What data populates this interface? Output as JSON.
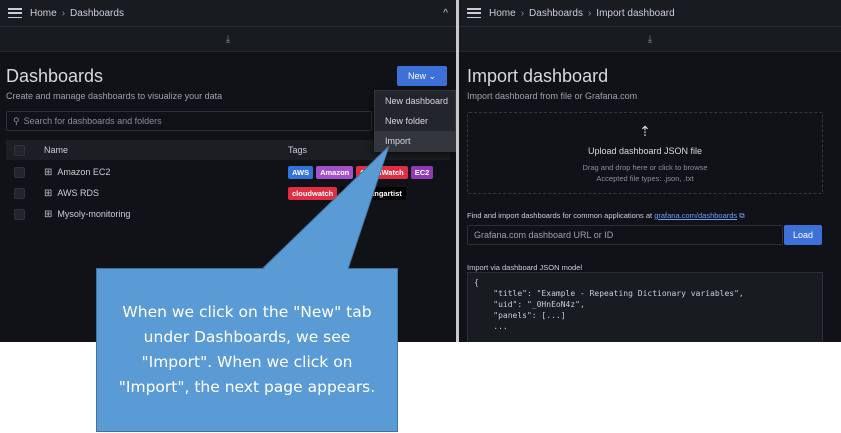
{
  "left": {
    "breadcrumb": [
      "Home",
      "Dashboards"
    ],
    "separator": "›",
    "collapse_icon": "^",
    "download_icon": "⤓",
    "title": "Dashboards",
    "subtitle": "Create and manage dashboards to visualize your data",
    "new_button": "New ⌄",
    "new_menu": [
      "New dashboard",
      "New folder",
      "Import"
    ],
    "search_placeholder": "Search for dashboards and folders",
    "table": {
      "headers": [
        "Name",
        "Tags"
      ],
      "rows": [
        {
          "name": "Amazon EC2",
          "tags": [
            {
              "label": "AWS",
              "color": "#3274d9"
            },
            {
              "label": "Amazon",
              "color": "#a352cc"
            },
            {
              "label": "CloudWatch",
              "color": "#e02f44"
            },
            {
              "label": "EC2",
              "color": "#8f3bb8"
            }
          ]
        },
        {
          "name": "AWS RDS",
          "tags": [
            {
              "label": "cloudwatch",
              "color": "#e02f44"
            },
            {
              "label": "monitoringartist",
              "color": "#000000"
            }
          ]
        },
        {
          "name": "Mysoly-monitoring",
          "tags": []
        }
      ]
    }
  },
  "right": {
    "breadcrumb": [
      "Home",
      "Dashboards",
      "Import dashboard"
    ],
    "separator": "›",
    "download_icon": "⤓",
    "title": "Import dashboard",
    "subtitle": "Import dashboard from file or Grafana.com",
    "upload_icon": "⇡",
    "upload_title": "Upload dashboard JSON file",
    "upload_hint_1": "Drag and drop here or click to browse",
    "upload_hint_2": "Accepted file types: .json, .txt",
    "gcom_label": "Find and import dashboards for common applications at",
    "gcom_link": "grafana.com/dashboards",
    "gcom_link_icon": "⧉",
    "gcom_placeholder": "Grafana.com dashboard URL or ID",
    "load_button": "Load",
    "json_label": "Import via dashboard JSON model",
    "json_text": "{\n    \"title\": \"Example - Repeating Dictionary variables\",\n    \"uid\": \"_0HnEoN4z\",\n    \"panels\": [...]\n    ..."
  },
  "callout": {
    "text": "When we click on the \"New\" tab under Dashboards, we see \"Import\". When we click on \"Import\", the next page appears."
  },
  "colors": {
    "background": "#111217",
    "primary": "#3d71d9",
    "callout": "#5b9bd5"
  }
}
